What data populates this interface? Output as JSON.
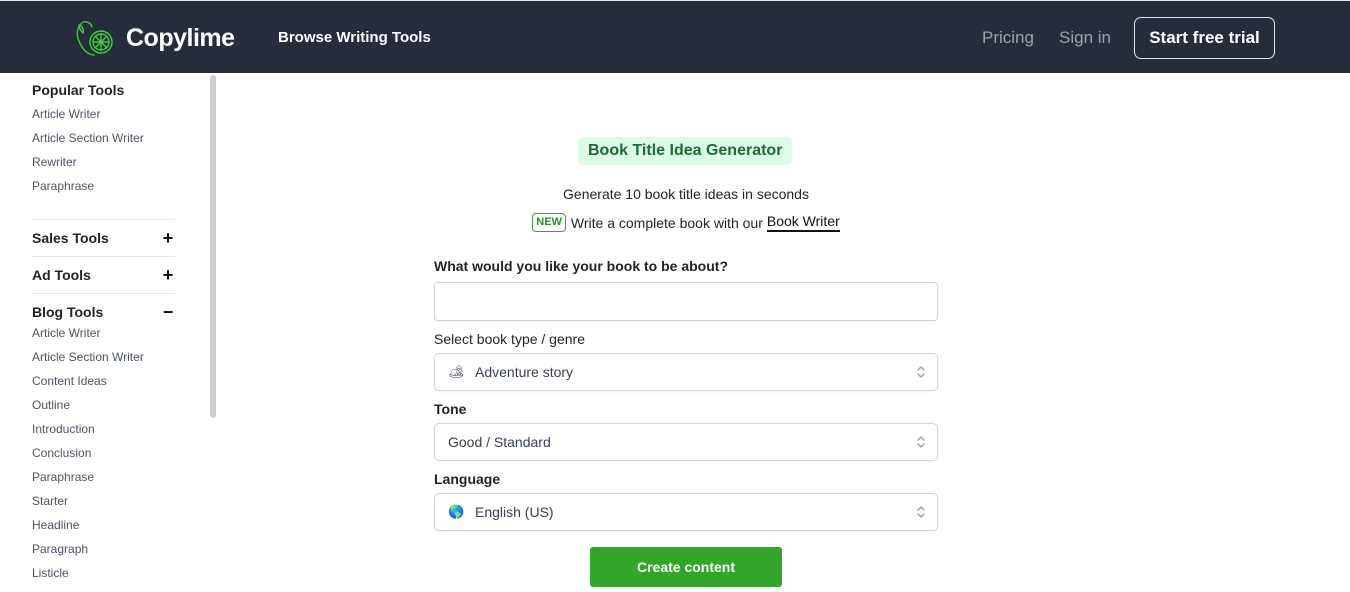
{
  "header": {
    "brand": "Copylime",
    "browse_label": "Browse Writing Tools",
    "pricing_label": "Pricing",
    "signin_label": "Sign in",
    "trial_label": "Start free trial",
    "logo_icon": "lime-icon",
    "brand_color": "#33a52a"
  },
  "sidebar": {
    "popular": {
      "title": "Popular Tools",
      "items": [
        "Article Writer",
        "Article Section Writer",
        "Rewriter",
        "Paraphrase"
      ]
    },
    "sections": [
      {
        "title": "Sales Tools",
        "toggle": "+"
      },
      {
        "title": "Ad Tools",
        "toggle": "+"
      },
      {
        "title": "Blog Tools",
        "toggle": "−"
      }
    ],
    "blog_items": [
      "Article Writer",
      "Article Section Writer",
      "Content Ideas",
      "Outline",
      "Introduction",
      "Conclusion",
      "Paraphrase",
      "Starter",
      "Headline",
      "Paragraph",
      "Listicle"
    ]
  },
  "main": {
    "badge": "Book Title Idea Generator",
    "subtitle": "Generate 10 book title ideas in seconds",
    "new_tag": "NEW",
    "promo_text": "Write a complete book with our",
    "promo_link": "Book Writer",
    "about_label": "What would you like your book to be about?",
    "about_value": "",
    "about_placeholder": "",
    "genre_label": "Select book type / genre",
    "genre_emoji": "🏕",
    "genre_value": "Adventure story",
    "tone_label": "Tone",
    "tone_value": "Good / Standard",
    "language_label": "Language",
    "language_emoji": "🌎",
    "language_value": "English (US)",
    "create_label": "Create content"
  }
}
